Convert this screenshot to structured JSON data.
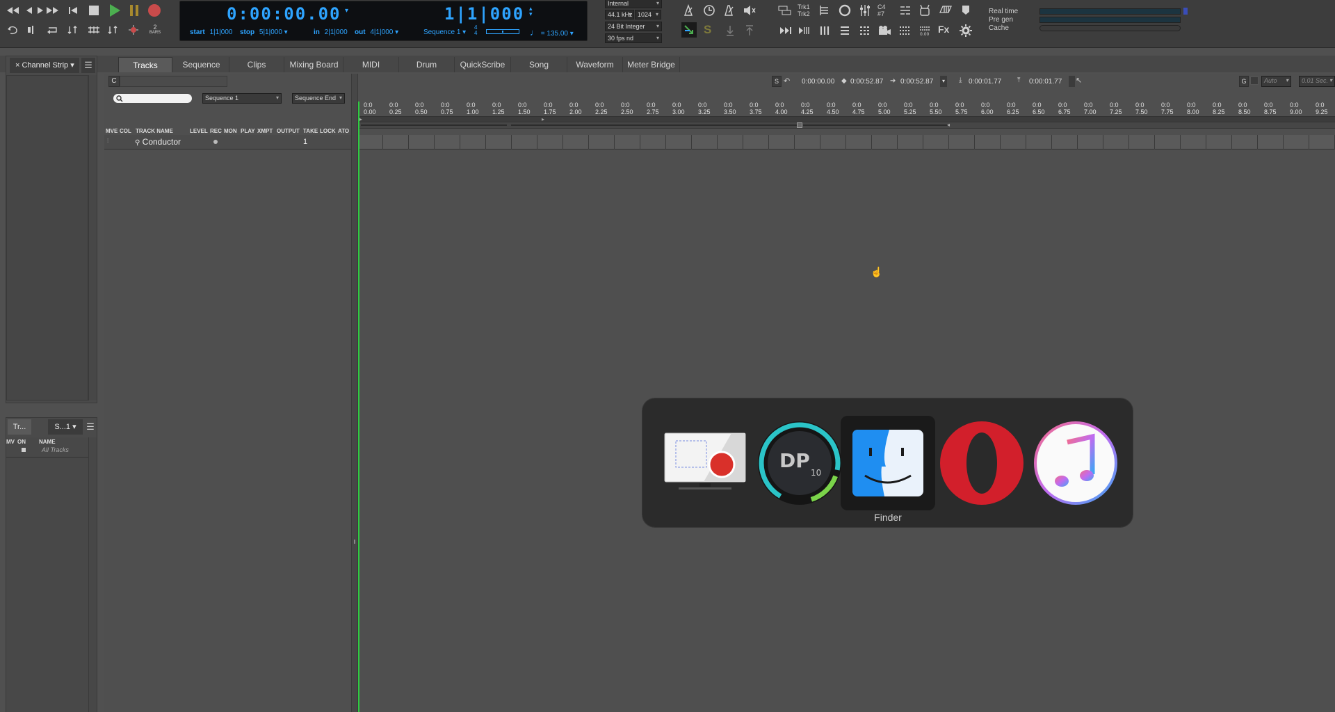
{
  "transport": {
    "main_counter": "0:00:00.00",
    "bar_counter": "1|1|000",
    "start_label": "start",
    "start_value": "1|1|000",
    "stop_label": "stop",
    "stop_value": "5|1|000",
    "in_label": "in",
    "in_value": "2|1|000",
    "out_label": "out",
    "out_value": "4|1|000",
    "sequence": "Sequence 1",
    "meter_num": "4",
    "meter_den": "4",
    "tempo": "135.00",
    "bars_label": "BARS",
    "bars_value": "2"
  },
  "engine": {
    "sync": "Internal",
    "sample_rate": "44.1 kHz",
    "buffer": "1024",
    "bit_depth": "24 Bit Integer",
    "frame_rate": "30 fps nd"
  },
  "track_labels": {
    "trk1": "Trk1",
    "trk2": "Trk2",
    "c4": "C4",
    "num": "#7"
  },
  "status": {
    "realtime": "Real time",
    "pregen": "Pre gen",
    "cache": "Cache",
    "realtime_level": 0.95,
    "pregen_level": 1.0
  },
  "tabs": [
    "Tracks",
    "Sequence",
    "Clips",
    "Mixing Board",
    "MIDI",
    "Drum",
    "QuickScribe",
    "Song",
    "Waveform",
    "Meter Bridge"
  ],
  "channel_strip": {
    "title": "Channel Strip",
    "close": "×"
  },
  "tracks_panel": {
    "tab1": "Tr...",
    "tab2": "S...1",
    "col_mv": "MV",
    "col_on": "ON",
    "col_name": "NAME",
    "all_tracks": "All Tracks"
  },
  "tracks_window": {
    "c_button": "C",
    "search_placeholder": "",
    "sequence_menu": "Sequence 1",
    "seq_end_menu": "Sequence End",
    "columns": [
      "MVE",
      "COL",
      "TRACK NAME",
      "LEVEL",
      "REC",
      "MON",
      "PLAY",
      "XMPT",
      "OUTPUT",
      "TAKE",
      "LOCK",
      "ATO"
    ],
    "track": {
      "name": "Conductor",
      "take": "1"
    },
    "s_button": "S",
    "time_start": "0:00:00.00",
    "time_end1": "0:00:52.87",
    "time_end2": "0:00:52.87",
    "time_in": "0:00:01.77",
    "time_out": "0:00:01.77",
    "g_button": "G",
    "auto_menu": "Auto",
    "grid_menu": "0.01 Sec.",
    "ruler_top": "0:0",
    "ruler": [
      "0.00",
      "0.25",
      "0.50",
      "0.75",
      "1.00",
      "1.25",
      "1.50",
      "1.75",
      "2.00",
      "2.25",
      "2.50",
      "2.75",
      "3.00",
      "3.25",
      "3.50",
      "3.75",
      "4.00",
      "4.25",
      "4.50",
      "4.75",
      "5.00",
      "5.25",
      "5.50",
      "5.75",
      "6.00",
      "6.25",
      "6.50",
      "6.75",
      "7.00",
      "7.25",
      "7.50",
      "7.75",
      "8.00",
      "8.25",
      "8.50",
      "8.75",
      "9.00",
      "9.25"
    ]
  },
  "switcher": {
    "apps": [
      "screen-recorder",
      "digital-performer",
      "finder",
      "opera",
      "itunes"
    ],
    "selected": "Finder",
    "dp_logo": "DP",
    "dp_version": "10"
  },
  "colors": {
    "lcd_blue": "#2ea4ff",
    "play_green": "#4caf50",
    "record_red": "#c94b4b",
    "playhead_green": "#2ecc40",
    "opera_red": "#d21f2b"
  }
}
